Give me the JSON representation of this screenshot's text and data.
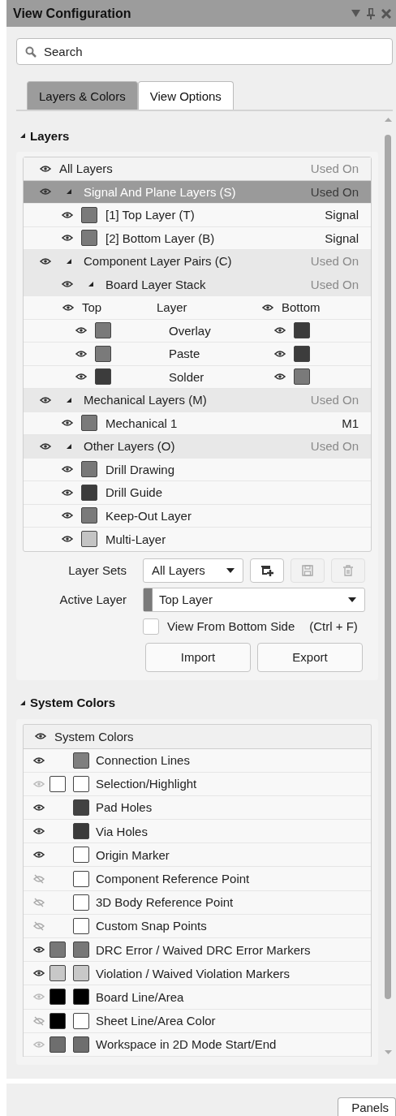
{
  "window": {
    "title": "View Configuration"
  },
  "search": {
    "placeholder": "Search"
  },
  "tabs": [
    {
      "label": "Layers & Colors",
      "selected": true
    },
    {
      "label": "View Options",
      "selected": false
    }
  ],
  "layers": {
    "title": "Layers",
    "expanded": true,
    "rows": [
      {
        "kind": "root",
        "label": "All Layers",
        "used": "Used On",
        "selected": false
      },
      {
        "kind": "group",
        "label": "Signal And Plane Layers (S)",
        "used": "Used On",
        "selected": true,
        "expanded": true,
        "children": [
          {
            "kind": "layer",
            "label": "[1] Top Layer (T)",
            "color": "#7a7a7a",
            "used": "Signal",
            "selected": false
          },
          {
            "kind": "layer",
            "label": "[2] Bottom Layer (B)",
            "color": "#7a7a7a",
            "used": "Signal",
            "selected": false
          }
        ]
      },
      {
        "kind": "group",
        "label": "Component Layer Pairs (C)",
        "used": "Used On",
        "selected": false,
        "expanded": true,
        "children": [
          {
            "kind": "group",
            "label": "Board Layer Stack",
            "used": "Used On",
            "selected": false,
            "expanded": true,
            "children": [
              {
                "kind": "pair-header",
                "top": "Top",
                "label": "Layer",
                "bottom": "Bottom"
              },
              {
                "kind": "pair",
                "label": "Overlay",
                "swatches": [
                  {
                    "color": "#7a7a7a"
                  },
                  {
                    "color": "#3c3c3c"
                  }
                ],
                "selected": false
              },
              {
                "kind": "pair",
                "label": "Paste",
                "swatches": [
                  {
                    "color": "#7a7a7a"
                  },
                  {
                    "color": "#3c3c3c"
                  }
                ],
                "selected": false
              },
              {
                "kind": "pair",
                "label": "Solder",
                "swatches": [
                  {
                    "color": "#3c3c3c"
                  },
                  {
                    "color": "#7a7a7a"
                  }
                ],
                "selected": false
              }
            ]
          }
        ]
      },
      {
        "kind": "group",
        "label": "Mechanical Layers (M)",
        "used": "Used On",
        "selected": false,
        "expanded": true,
        "children": [
          {
            "kind": "layer",
            "label": "Mechanical 1",
            "color": "#7a7a7a",
            "used": "M1",
            "selected": false
          }
        ]
      },
      {
        "kind": "group",
        "label": "Other Layers (O)",
        "used": "Used On",
        "selected": false,
        "expanded": true,
        "children": [
          {
            "kind": "layer",
            "label": "Drill Drawing",
            "color": "#787878",
            "selected": false
          },
          {
            "kind": "layer",
            "label": "Drill Guide",
            "color": "#3c3c3c",
            "selected": false
          },
          {
            "kind": "layer",
            "label": "Keep-Out Layer",
            "color": "#7a7a7a",
            "selected": false
          },
          {
            "kind": "layer",
            "label": "Multi-Layer",
            "color": "#c4c4c4",
            "selected": false
          }
        ]
      }
    ]
  },
  "layer_sets": {
    "label": "Layer Sets",
    "value": "All Layers",
    "buttons": [
      {
        "kind": "add",
        "disabled": false
      },
      {
        "kind": "save",
        "disabled": true
      },
      {
        "kind": "delete",
        "disabled": true
      }
    ]
  },
  "active_layer": {
    "label": "Active Layer",
    "value": "Top Layer",
    "color": "#7a7a7a"
  },
  "view_from_bottom": {
    "label": "View From Bottom Side",
    "shortcut": "(Ctrl + F)",
    "checked": false
  },
  "buttons": [
    "Import",
    "Export"
  ],
  "system_colors": {
    "title": "System Colors",
    "expanded": true,
    "header": "System Colors",
    "rows": [
      {
        "label": "Connection Lines",
        "visible": true,
        "dimmed": false,
        "swatches": [
          {
            "color": "#7f7f7f"
          }
        ]
      },
      {
        "label": "Selection/Highlight",
        "visible": true,
        "dimmed": true,
        "swatches": [
          {
            "color": "#ffffff"
          },
          {
            "color": "#ffffff"
          }
        ]
      },
      {
        "label": "Pad Holes",
        "visible": true,
        "dimmed": false,
        "swatches": [
          {
            "color": "#424242"
          }
        ]
      },
      {
        "label": "Via Holes",
        "visible": true,
        "dimmed": false,
        "swatches": [
          {
            "color": "#3a3a3a"
          }
        ]
      },
      {
        "label": "Origin Marker",
        "visible": true,
        "dimmed": false,
        "swatches": [
          {
            "color": "#ffffff"
          }
        ]
      },
      {
        "label": "Component Reference Point",
        "visible": false,
        "dimmed": true,
        "swatches": [
          {
            "color": "#ffffff"
          }
        ]
      },
      {
        "label": "3D Body Reference Point",
        "visible": false,
        "dimmed": true,
        "swatches": [
          {
            "color": "#ffffff"
          }
        ]
      },
      {
        "label": "Custom Snap Points",
        "visible": false,
        "dimmed": true,
        "swatches": [
          {
            "color": "#ffffff"
          }
        ]
      },
      {
        "label": "DRC Error / Waived DRC Error Markers",
        "visible": true,
        "dimmed": false,
        "swatches": [
          {
            "color": "#777777"
          },
          {
            "color": "#777777"
          }
        ]
      },
      {
        "label": "Violation / Waived Violation Markers",
        "visible": true,
        "dimmed": false,
        "swatches": [
          {
            "color": "#c8c8c8"
          },
          {
            "color": "#c8c8c8"
          }
        ]
      },
      {
        "label": "Board Line/Area",
        "visible": true,
        "dimmed": true,
        "swatches": [
          {
            "color": "#000000"
          },
          {
            "color": "#000000"
          }
        ]
      },
      {
        "label": "Sheet Line/Area Color",
        "visible": false,
        "dimmed": true,
        "swatches": [
          {
            "color": "#000000"
          },
          {
            "color": "#ffffff"
          }
        ]
      },
      {
        "label": "Workspace in 2D Mode Start/End",
        "visible": true,
        "dimmed": true,
        "swatches": [
          {
            "color": "#6e6e6e"
          },
          {
            "color": "#6e6e6e"
          }
        ]
      }
    ]
  },
  "footer": {
    "button": "Panels"
  }
}
